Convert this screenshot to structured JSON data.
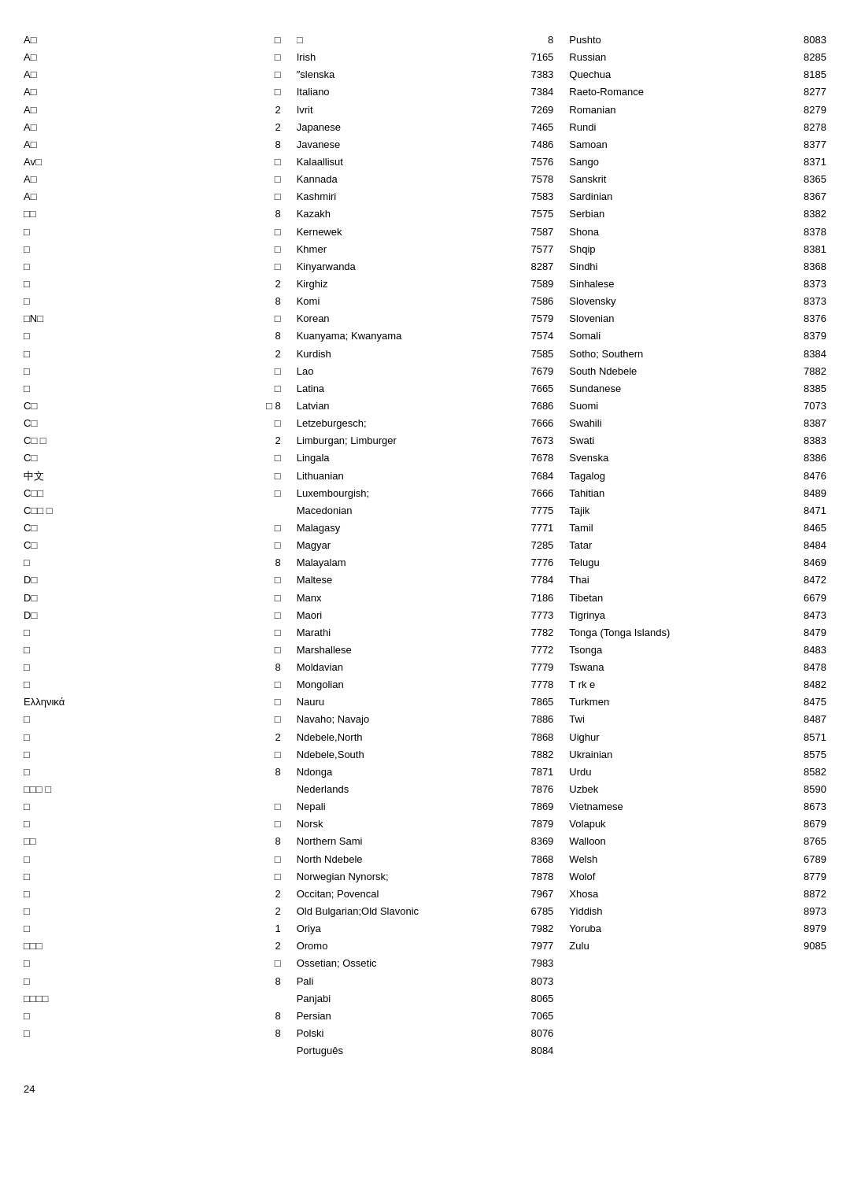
{
  "page": {
    "number": "24"
  },
  "col1": {
    "rows": [
      {
        "name": "A□",
        "code": "□"
      },
      {
        "name": "A□",
        "code": "□"
      },
      {
        "name": "A□",
        "code": "□"
      },
      {
        "name": "A□",
        "code": "□"
      },
      {
        "name": "A□",
        "code": "2"
      },
      {
        "name": "A□",
        "code": "2"
      },
      {
        "name": "A□",
        "code": "8"
      },
      {
        "name": "Av□",
        "code": "□"
      },
      {
        "name": "A□",
        "code": "□"
      },
      {
        "name": "A□",
        "code": "□"
      },
      {
        "name": "□□",
        "code": "8"
      },
      {
        "name": "□",
        "code": "□"
      },
      {
        "name": "□",
        "code": "□"
      },
      {
        "name": "□",
        "code": "□"
      },
      {
        "name": "□",
        "code": "2"
      },
      {
        "name": "□",
        "code": "8"
      },
      {
        "name": "□N□",
        "code": "□"
      },
      {
        "name": "□",
        "code": "8"
      },
      {
        "name": "□",
        "code": "2"
      },
      {
        "name": "□",
        "code": "□"
      },
      {
        "name": "□",
        "code": "□"
      },
      {
        "name": "C□",
        "code": "□  8"
      },
      {
        "name": "C□",
        "code": "□"
      },
      {
        "name": "C□  □",
        "code": "2"
      },
      {
        "name": "C□",
        "code": "□"
      },
      {
        "name": "中文",
        "code": "□"
      },
      {
        "name": "C□□",
        "code": "□"
      },
      {
        "name": "C□□ □",
        "code": ""
      },
      {
        "name": "C□",
        "code": "□"
      },
      {
        "name": "C□",
        "code": "□"
      },
      {
        "name": "□",
        "code": "8"
      },
      {
        "name": "D□",
        "code": "□"
      },
      {
        "name": "D□",
        "code": "□"
      },
      {
        "name": "D□",
        "code": "□"
      },
      {
        "name": "□",
        "code": "□"
      },
      {
        "name": "□",
        "code": "□"
      },
      {
        "name": "□",
        "code": "8"
      },
      {
        "name": "□",
        "code": "□"
      },
      {
        "name": "Ελληνικά",
        "code": "□"
      },
      {
        "name": "□",
        "code": "□"
      },
      {
        "name": "□",
        "code": "2"
      },
      {
        "name": "□",
        "code": "□"
      },
      {
        "name": "□",
        "code": "8"
      },
      {
        "name": "□□□ □",
        "code": ""
      },
      {
        "name": "□",
        "code": "□"
      },
      {
        "name": "□",
        "code": "□"
      },
      {
        "name": "□□",
        "code": "8"
      },
      {
        "name": "□",
        "code": "□"
      },
      {
        "name": "□",
        "code": "□"
      },
      {
        "name": "□",
        "code": "2"
      },
      {
        "name": "□",
        "code": "2"
      },
      {
        "name": "□",
        "code": "1"
      },
      {
        "name": "□□□",
        "code": "2"
      },
      {
        "name": "□",
        "code": "□"
      },
      {
        "name": "□",
        "code": "8"
      },
      {
        "name": "□□□□",
        "code": ""
      },
      {
        "name": "□",
        "code": "8"
      },
      {
        "name": "□",
        "code": "8"
      }
    ]
  },
  "col2": {
    "rows": [
      {
        "name": "□",
        "code": "8"
      },
      {
        "name": "Irish",
        "code": "7165"
      },
      {
        "name": "″slenska",
        "code": "7383"
      },
      {
        "name": "Italiano",
        "code": "7384"
      },
      {
        "name": "Ivrit",
        "code": "7269"
      },
      {
        "name": "Japanese",
        "code": "7465"
      },
      {
        "name": "Javanese",
        "code": "7486"
      },
      {
        "name": "Kalaallisut",
        "code": "7576"
      },
      {
        "name": "Kannada",
        "code": "7578"
      },
      {
        "name": "Kashmiri",
        "code": "7583"
      },
      {
        "name": "Kazakh",
        "code": "7575"
      },
      {
        "name": "Kernewek",
        "code": "7587"
      },
      {
        "name": "Khmer",
        "code": "7577"
      },
      {
        "name": "Kinyarwanda",
        "code": "8287"
      },
      {
        "name": "Kirghiz",
        "code": "7589"
      },
      {
        "name": "Komi",
        "code": "7586"
      },
      {
        "name": "Korean",
        "code": "7579"
      },
      {
        "name": "Kuanyama; Kwanyama",
        "code": "7574"
      },
      {
        "name": "Kurdish",
        "code": "7585"
      },
      {
        "name": "Lao",
        "code": "7679"
      },
      {
        "name": "Latina",
        "code": "7665"
      },
      {
        "name": "Latvian",
        "code": "7686"
      },
      {
        "name": "Letzeburgesch;",
        "code": "7666"
      },
      {
        "name": "Limburgan; Limburger",
        "code": "7673"
      },
      {
        "name": "Lingala",
        "code": "7678"
      },
      {
        "name": "Lithuanian",
        "code": "7684"
      },
      {
        "name": "Luxembourgish;",
        "code": "7666"
      },
      {
        "name": "Macedonian",
        "code": "7775"
      },
      {
        "name": "Malagasy",
        "code": "7771"
      },
      {
        "name": "Magyar",
        "code": "7285"
      },
      {
        "name": "Malayalam",
        "code": "7776"
      },
      {
        "name": "Maltese",
        "code": "7784"
      },
      {
        "name": "Manx",
        "code": "7186"
      },
      {
        "name": "Maori",
        "code": "7773"
      },
      {
        "name": "Marathi",
        "code": "7782"
      },
      {
        "name": "Marshallese",
        "code": "7772"
      },
      {
        "name": "Moldavian",
        "code": "7779"
      },
      {
        "name": "Mongolian",
        "code": "7778"
      },
      {
        "name": "Nauru",
        "code": "7865"
      },
      {
        "name": "Navaho; Navajo",
        "code": "7886"
      },
      {
        "name": "Ndebele,North",
        "code": "7868"
      },
      {
        "name": "Ndebele,South",
        "code": "7882"
      },
      {
        "name": "Ndonga",
        "code": "7871"
      },
      {
        "name": "Nederlands",
        "code": "7876"
      },
      {
        "name": "Nepali",
        "code": "7869"
      },
      {
        "name": "Norsk",
        "code": "7879"
      },
      {
        "name": "Northern Sami",
        "code": "8369"
      },
      {
        "name": "North Ndebele",
        "code": "7868"
      },
      {
        "name": "Norwegian Nynorsk;",
        "code": "7878"
      },
      {
        "name": "Occitan; Povencal",
        "code": "7967"
      },
      {
        "name": "Old Bulgarian;Old Slavonic",
        "code": "6785"
      },
      {
        "name": "Oriya",
        "code": "7982"
      },
      {
        "name": "Oromo",
        "code": "7977"
      },
      {
        "name": "Ossetian; Ossetic",
        "code": "7983"
      },
      {
        "name": "Pali",
        "code": "8073"
      },
      {
        "name": "Panjabi",
        "code": "8065"
      },
      {
        "name": "Persian",
        "code": "7065"
      },
      {
        "name": "Polski",
        "code": "8076"
      },
      {
        "name": "Português",
        "code": "8084"
      }
    ]
  },
  "col3": {
    "rows": [
      {
        "name": "Pushto",
        "code": "8083"
      },
      {
        "name": "Russian",
        "code": "8285"
      },
      {
        "name": "Quechua",
        "code": "8185"
      },
      {
        "name": "Raeto-Romance",
        "code": "8277"
      },
      {
        "name": "Romanian",
        "code": "8279"
      },
      {
        "name": "Rundi",
        "code": "8278"
      },
      {
        "name": "Samoan",
        "code": "8377"
      },
      {
        "name": "Sango",
        "code": "8371"
      },
      {
        "name": "Sanskrit",
        "code": "8365"
      },
      {
        "name": "Sardinian",
        "code": "8367"
      },
      {
        "name": "Serbian",
        "code": "8382"
      },
      {
        "name": "Shona",
        "code": "8378"
      },
      {
        "name": "Shqip",
        "code": "8381"
      },
      {
        "name": "Sindhi",
        "code": "8368"
      },
      {
        "name": "Sinhalese",
        "code": "8373"
      },
      {
        "name": "Slovensky",
        "code": "8373"
      },
      {
        "name": "Slovenian",
        "code": "8376"
      },
      {
        "name": "Somali",
        "code": "8379"
      },
      {
        "name": "Sotho; Southern",
        "code": "8384"
      },
      {
        "name": "South Ndebele",
        "code": "7882"
      },
      {
        "name": "Sundanese",
        "code": "8385"
      },
      {
        "name": "Suomi",
        "code": "7073"
      },
      {
        "name": "Swahili",
        "code": "8387"
      },
      {
        "name": "Swati",
        "code": "8383"
      },
      {
        "name": "Svenska",
        "code": "8386"
      },
      {
        "name": "Tagalog",
        "code": "8476"
      },
      {
        "name": "Tahitian",
        "code": "8489"
      },
      {
        "name": "Tajik",
        "code": "8471"
      },
      {
        "name": "Tamil",
        "code": "8465"
      },
      {
        "name": "Tatar",
        "code": "8484"
      },
      {
        "name": "Telugu",
        "code": "8469"
      },
      {
        "name": "Thai",
        "code": "8472"
      },
      {
        "name": "Tibetan",
        "code": "6679"
      },
      {
        "name": "Tigrinya",
        "code": "8473"
      },
      {
        "name": "Tonga (Tonga Islands)",
        "code": "8479"
      },
      {
        "name": "Tsonga",
        "code": "8483"
      },
      {
        "name": "Tswana",
        "code": "8478"
      },
      {
        "name": "T rk e",
        "code": "8482"
      },
      {
        "name": "Turkmen",
        "code": "8475"
      },
      {
        "name": "Twi",
        "code": "8487"
      },
      {
        "name": "Uighur",
        "code": "8571"
      },
      {
        "name": "Ukrainian",
        "code": "8575"
      },
      {
        "name": "Urdu",
        "code": "8582"
      },
      {
        "name": "Uzbek",
        "code": "8590"
      },
      {
        "name": "Vietnamese",
        "code": "8673"
      },
      {
        "name": "Volapuk",
        "code": "8679"
      },
      {
        "name": "Walloon",
        "code": "8765"
      },
      {
        "name": "Welsh",
        "code": "6789"
      },
      {
        "name": "Wolof",
        "code": "8779"
      },
      {
        "name": "Xhosa",
        "code": "8872"
      },
      {
        "name": "Yiddish",
        "code": "8973"
      },
      {
        "name": "Yoruba",
        "code": "8979"
      },
      {
        "name": "Zulu",
        "code": "9085"
      }
    ]
  }
}
